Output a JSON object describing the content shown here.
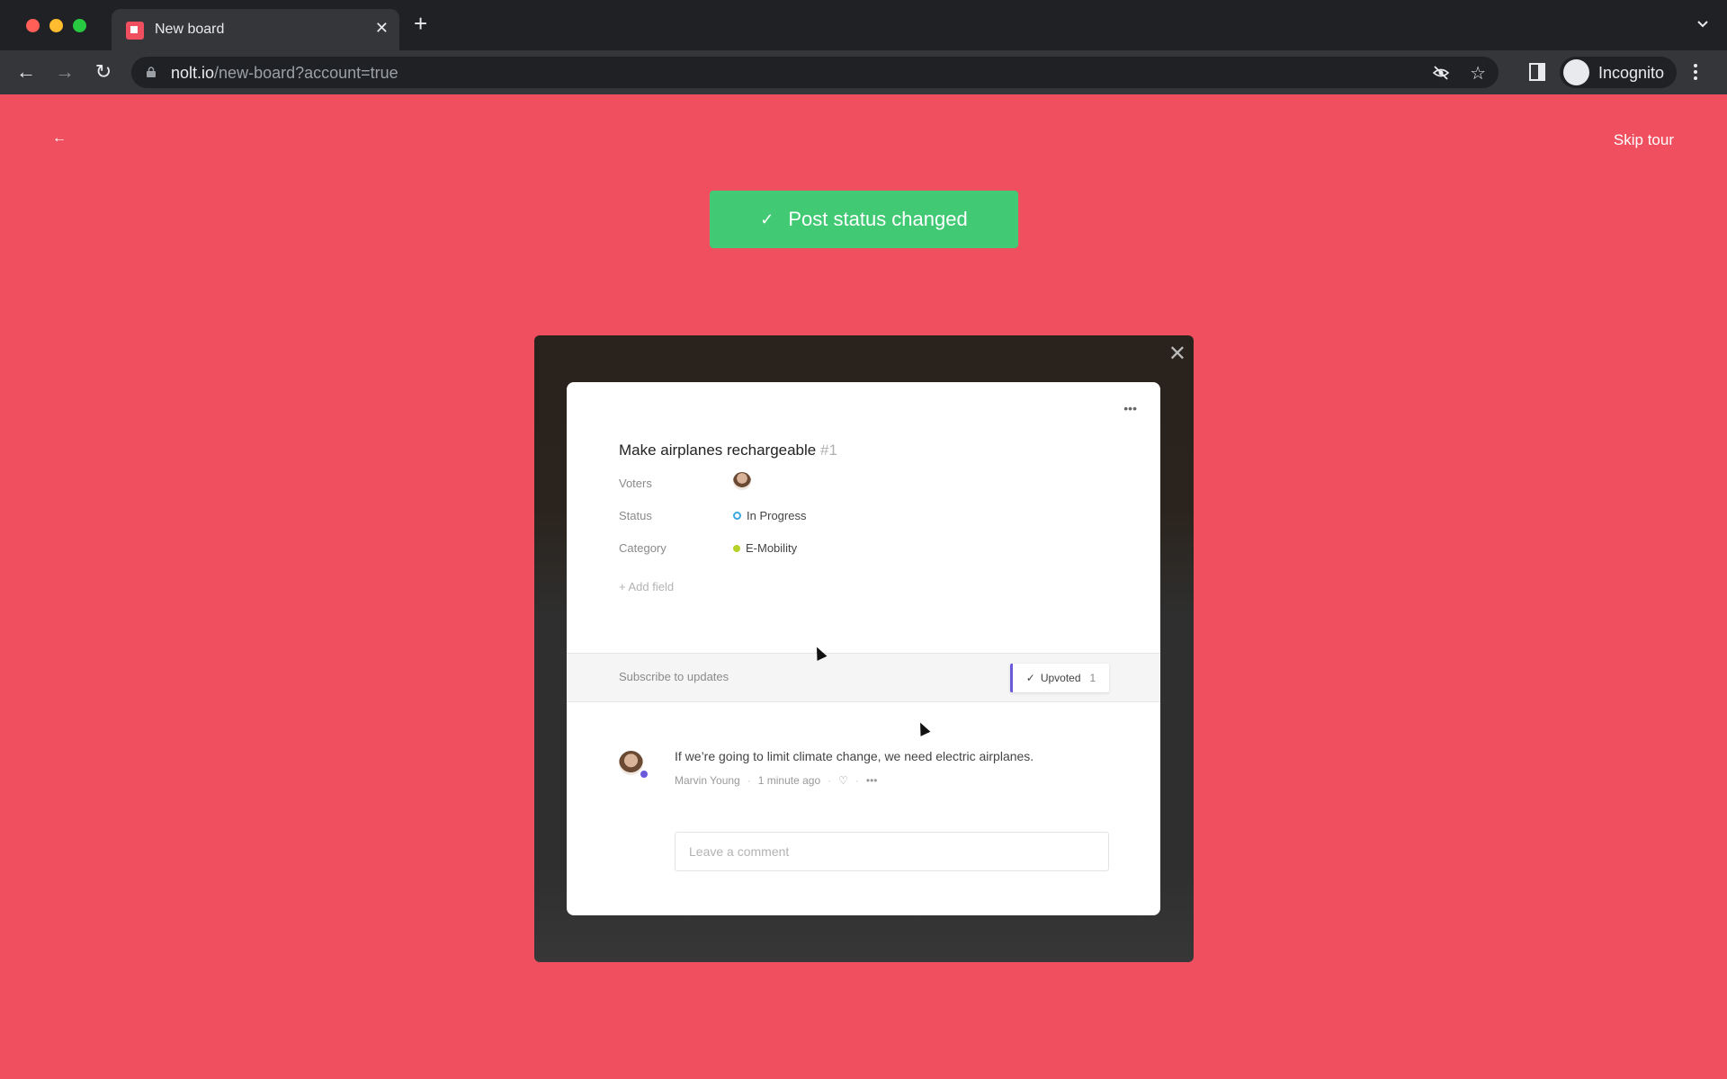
{
  "browser": {
    "tab_title": "New board",
    "url_host": "nolt.io",
    "url_path": "/new-board?account=true",
    "profile_label": "Incognito"
  },
  "page": {
    "skip_tour": "Skip tour",
    "back_icon": "arrow-left-icon",
    "toast": {
      "icon": "check-icon",
      "message": "Post status changed",
      "color": "#41c974"
    },
    "background_color": "#ef4f5e"
  },
  "post": {
    "title": "Make airplanes rechargeable",
    "number": "#1",
    "fields": [
      {
        "label": "Voters",
        "value": ""
      },
      {
        "label": "Status",
        "value": "In Progress",
        "color": "#3aa8e0"
      },
      {
        "label": "Category",
        "value": "E-Mobility",
        "color": "#b5d12a"
      }
    ],
    "add_field": "+ Add field",
    "subscribe": "Subscribe to updates",
    "upvote": {
      "label": "Upvoted",
      "count": "1",
      "check": "✓"
    },
    "comment": {
      "text": "If we’re going to limit climate change, we need electric airplanes.",
      "author": "Marvin Young",
      "time": "1 minute ago"
    },
    "comment_placeholder": "Leave a comment"
  }
}
